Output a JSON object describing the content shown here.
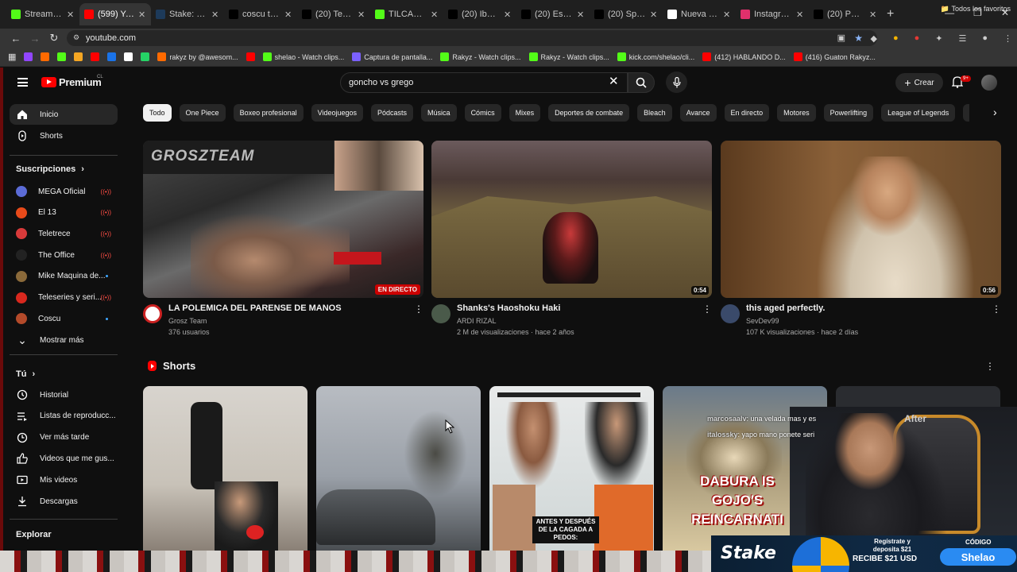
{
  "browser": {
    "tabs": [
      {
        "title": "Stream - Kick",
        "color": "#53fc18"
      },
      {
        "title": "(599) YouTube",
        "color": "#ff0000",
        "active": true
      },
      {
        "title": "Stake: Casino",
        "color": "#1d3a5a"
      },
      {
        "title": "coscu tira fa",
        "color": "#000000"
      },
      {
        "title": "(20) Tendenc",
        "color": "#000000"
      },
      {
        "title": "TILCARA - W",
        "color": "#53fc18"
      },
      {
        "title": "(20) Ibai on",
        "color": "#000000"
      },
      {
        "title": "(20) Es tende",
        "color": "#000000"
      },
      {
        "title": "(20) Speed e",
        "color": "#000000"
      },
      {
        "title": "Nueva pesta",
        "color": "#ffffff"
      },
      {
        "title": "Instagram",
        "color": "#e1306c"
      },
      {
        "title": "(20) PWR se",
        "color": "#000000"
      }
    ],
    "url": "youtube.com",
    "bookmarks": [
      {
        "label": "",
        "color": "#9146ff"
      },
      {
        "label": "",
        "color": "#ff6a00"
      },
      {
        "label": "",
        "color": "#53fc18"
      },
      {
        "label": "",
        "color": "#f5a623"
      },
      {
        "label": "",
        "color": "#ff0000"
      },
      {
        "label": "",
        "color": "#1a73e8"
      },
      {
        "label": "",
        "color": "#ffffff"
      },
      {
        "label": "",
        "color": "#25d366"
      },
      {
        "label": "rakyz by @awesom...",
        "color": "#ff6a00"
      },
      {
        "label": "",
        "color": "#ff0000"
      },
      {
        "label": "shelao - Watch clips...",
        "color": "#53fc18"
      },
      {
        "label": "Captura de pantalla...",
        "color": "#7b61ff"
      },
      {
        "label": "Rakyz - Watch clips...",
        "color": "#53fc18"
      },
      {
        "label": "Rakyz - Watch clips...",
        "color": "#53fc18"
      },
      {
        "label": "kick.com/shelao/cli...",
        "color": "#53fc18"
      },
      {
        "label": "(412) HABLANDO D...",
        "color": "#ff0000"
      },
      {
        "label": "(416) Guaton Rakyz...",
        "color": "#ff0000"
      }
    ],
    "all_bookmarks": "Todos los favoritos"
  },
  "youtube": {
    "logo": "Premium",
    "region": "CL",
    "search": "goncho vs grego",
    "create": "Crear",
    "notif_count": "9+",
    "sidebar": {
      "main": [
        {
          "label": "Inicio",
          "icon": "home-icon",
          "active": true
        },
        {
          "label": "Shorts",
          "icon": "shorts-icon"
        }
      ],
      "subs_title": "Suscripciones",
      "subs": [
        {
          "label": "MEGA Oficial",
          "color": "#5b6bd6",
          "status": "live"
        },
        {
          "label": "El 13",
          "color": "#e84a1a",
          "status": "live"
        },
        {
          "label": "Teletrece",
          "color": "#d83a3a",
          "status": "live"
        },
        {
          "label": "The Office",
          "color": "#222222",
          "status": "live"
        },
        {
          "label": "Mike Maquina de...",
          "color": "#8b6a3a",
          "status": "new"
        },
        {
          "label": "Teleseries y seri...",
          "color": "#d8281e",
          "status": "live"
        },
        {
          "label": "Coscu",
          "color": "#b44a2a",
          "status": "new"
        }
      ],
      "show_more": "Mostrar más",
      "you_title": "Tú",
      "you": [
        {
          "label": "Historial",
          "icon": "history-icon"
        },
        {
          "label": "Listas de reproducc...",
          "icon": "playlist-icon"
        },
        {
          "label": "Ver más tarde",
          "icon": "clock-icon"
        },
        {
          "label": "Videos que me gus...",
          "icon": "thumbs-up-icon"
        },
        {
          "label": "Mis videos",
          "icon": "my-videos-icon"
        },
        {
          "label": "Descargas",
          "icon": "download-icon"
        }
      ],
      "explore_title": "Explorar"
    },
    "chips": [
      "Todo",
      "One Piece",
      "Boxeo profesional",
      "Videojuegos",
      "Pódcasts",
      "Música",
      "Cómics",
      "Mixes",
      "Deportes de combate",
      "Bleach",
      "Avance",
      "En directo",
      "Motores",
      "Powerlifting",
      "League of Legends",
      "Tr"
    ],
    "videos": [
      {
        "title": "LA POLEMICA DEL PARENSE DE MANOS",
        "channel": "Grosz Team",
        "stats": "376 usuarios",
        "badge": "EN DIRECTO",
        "overlay": "GROSZTEAM",
        "avatar_color": "#ffffff"
      },
      {
        "title": "Shanks's Haoshoku Haki",
        "channel": "ARDI RIZAL",
        "stats": "2 M de visualizaciones · hace 2 años",
        "badge": "0:54",
        "avatar_color": "#4a5a4a"
      },
      {
        "title": "this aged perfectly.",
        "channel": "SevDev99",
        "stats": "107 K visualizaciones · hace 2 días",
        "badge": "0:56",
        "avatar_color": "#3a4a6a"
      }
    ],
    "shorts_title": "Shorts",
    "shorts": [
      {
        "caption": ""
      },
      {
        "caption": ""
      },
      {
        "caption": "ANTES Y DESPUÉS DE LA CAGADA A PEDOS:"
      },
      {
        "caption": "DABURA IS GOJO'S REINCARNATI"
      },
      {
        "caption": "After"
      }
    ]
  },
  "overlay": {
    "chat": [
      {
        "user": "marcosaalv",
        "text": ": una velada mas y es"
      },
      {
        "user": "italossky",
        "text": ": yapo mano ponete seri"
      }
    ],
    "stake": {
      "logo": "Stake",
      "promo1": "Regístrate y deposita $21",
      "promo2": "RECIBE $21 USD",
      "code_label": "CÓDIGO",
      "code": "Shelao"
    }
  }
}
